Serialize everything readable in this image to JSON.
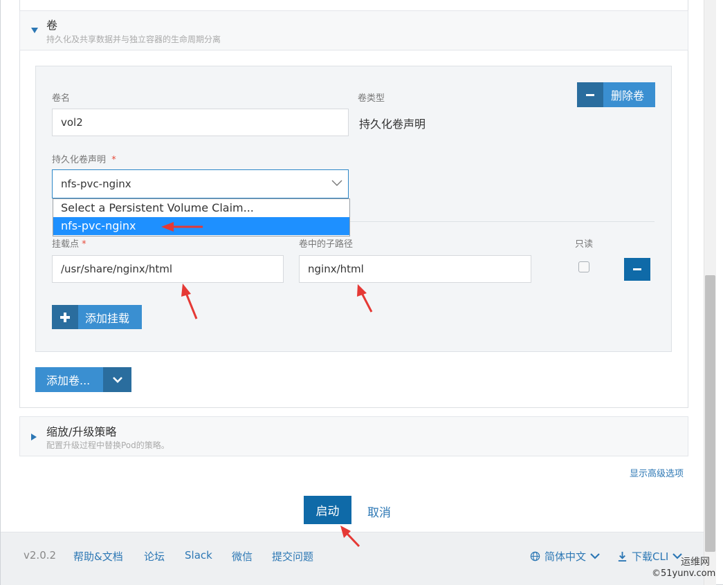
{
  "volumes_section": {
    "title": "卷",
    "subtitle": "持久化及共享数据并与独立容器的生命周期分离"
  },
  "volume": {
    "name_label": "卷名",
    "name_value": "vol2",
    "type_label": "卷类型",
    "type_value": "持久化卷声明",
    "delete_label": "删除卷",
    "pvc_label": "持久化卷声明",
    "pvc_required": "*",
    "pvc_value": "nfs-pvc-nginx",
    "pvc_options": [
      "Select a Persistent Volume Claim...",
      "nfs-pvc-nginx"
    ],
    "mount": {
      "mount_point_label": "挂载点",
      "mount_point_required": "*",
      "mount_point_value": "/usr/share/nginx/html",
      "sub_path_label": "卷中的子路径",
      "sub_path_value": "nginx/html",
      "readonly_label": "只读"
    },
    "add_mount_label": "添加挂载"
  },
  "add_volume_label": "添加卷...",
  "scaling_section": {
    "title": "缩放/升级策略",
    "subtitle": "配置升级过程中替换Pod的策略。"
  },
  "advanced_link": "显示高级选项",
  "launch_label": "启动",
  "cancel_label": "取消",
  "footer": {
    "version": "v2.0.2",
    "help": "帮助&文档",
    "forum": "论坛",
    "slack": "Slack",
    "wechat": "微信",
    "issue": "提交问题",
    "language": "简体中文",
    "download": "下载CLI"
  },
  "watermark": {
    "line1": "运维网",
    "line2": "©51yunv.com"
  },
  "colors": {
    "primary": "#3a8fd1",
    "primary_dark": "#0f6aa8",
    "link": "#2c77b4",
    "annotation_arrow": "#e53935"
  }
}
